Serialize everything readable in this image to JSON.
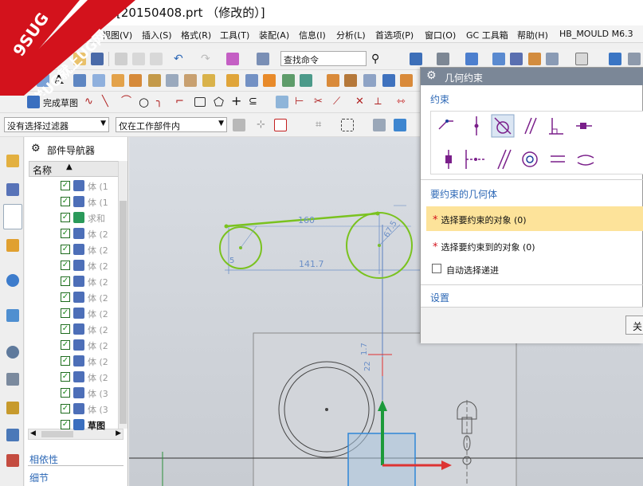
{
  "window": {
    "title": "[20150408.prt （修改的）]"
  },
  "watermark": {
    "line1": "9SUG",
    "line2": "学UG就上UG网"
  },
  "menu": {
    "items": [
      "视图(V)",
      "插入(S)",
      "格式(R)",
      "工具(T)",
      "装配(A)",
      "信息(I)",
      "分析(L)",
      "首选项(P)",
      "窗口(O)",
      "GC 工具箱",
      "帮助(H)",
      "HB_MOULD M6.3"
    ]
  },
  "toolbar": {
    "search_placeholder": "查找命令",
    "finish_sketch_label": "完成草图",
    "text_tool_label": "A",
    "filter_select": "没有选择过滤器",
    "scope_select": "仅在工作部件内"
  },
  "navigator": {
    "title": "部件导航器",
    "column_name": "名称",
    "rows": [
      {
        "label": "体 (1",
        "checked": true
      },
      {
        "label": "体 (1",
        "checked": true
      },
      {
        "label": "求和",
        "checked": true
      },
      {
        "label": "体 (2",
        "checked": true
      },
      {
        "label": "体 (2",
        "checked": true
      },
      {
        "label": "体 (2",
        "checked": true
      },
      {
        "label": "体 (2",
        "checked": true
      },
      {
        "label": "体 (2",
        "checked": true
      },
      {
        "label": "体 (2",
        "checked": true
      },
      {
        "label": "体 (2",
        "checked": true
      },
      {
        "label": "体 (2",
        "checked": true
      },
      {
        "label": "体 (2",
        "checked": true
      },
      {
        "label": "体 (2",
        "checked": true
      },
      {
        "label": "体 (3",
        "checked": true
      },
      {
        "label": "体 (3",
        "checked": true
      },
      {
        "label": "草图",
        "checked": true
      }
    ],
    "dependency_label": "相依性",
    "details_label": "细节"
  },
  "sketch": {
    "dim_160": "160",
    "dim_141_7": "141.7",
    "dim_67_5": "67.5",
    "dim_5": "5",
    "dim_1_7": "1.7",
    "dim_22": "22"
  },
  "dialog": {
    "title": "几何约束",
    "section_constraints": "约束",
    "section_geometry": "要约束的几何体",
    "select_object": "选择要约束的对象 (0)",
    "select_target": "选择要约束到的对象 (0)",
    "auto_chain_label": "自动选择递进",
    "auto_chain_checked": false,
    "section_settings": "设置",
    "close_button": "关"
  },
  "colors": {
    "accent": "#2d68b6",
    "dialog_title_bg": "#7b8797",
    "highlight_row": "#fde39a",
    "sketch_green": "#7ac21f",
    "dimension_blue": "#6b8fc7",
    "watermark_red": "#d3121c"
  }
}
